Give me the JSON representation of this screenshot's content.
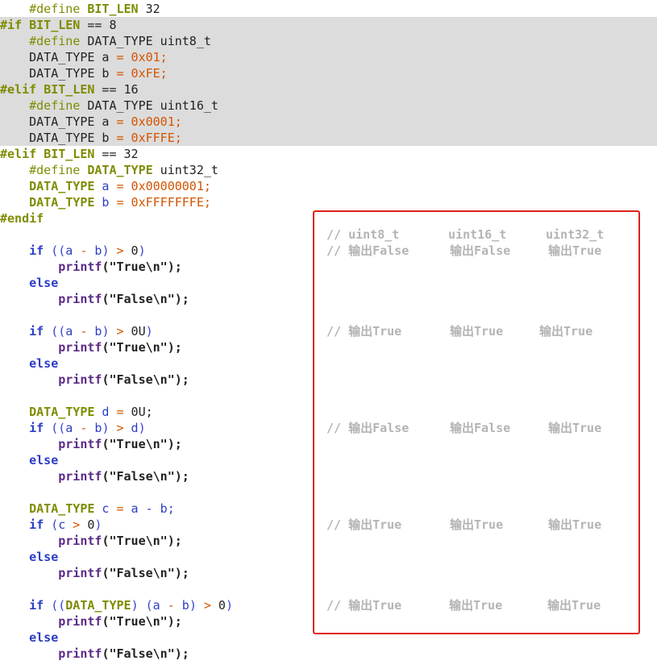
{
  "code": {
    "l1": {
      "a": "#define ",
      "b": "BIT_LEN",
      "c": " 32"
    },
    "l2": {
      "a": "#if ",
      "b": "BIT_LEN",
      "c": " == ",
      "d": "8"
    },
    "l3": {
      "a": "#define ",
      "b": "DATA_TYPE uint8_t"
    },
    "l4": {
      "a": "DATA_TYPE a ",
      "b": "=",
      "c": " 0x01;"
    },
    "l5": {
      "a": "DATA_TYPE b ",
      "b": "=",
      "c": " 0xFE;"
    },
    "l6": {
      "a": "#elif ",
      "b": "BIT_LEN",
      "c": " == ",
      "d": "16"
    },
    "l7": {
      "a": "#define ",
      "b": "DATA_TYPE uint16_t"
    },
    "l8": {
      "a": "DATA_TYPE a ",
      "b": "=",
      "c": " 0x0001;"
    },
    "l9": {
      "a": "DATA_TYPE b ",
      "b": "=",
      "c": " 0xFFFE;"
    },
    "l10": {
      "a": "#elif ",
      "b": "BIT_LEN",
      "c": " == ",
      "d": "32"
    },
    "l11": {
      "a": "#define ",
      "b": "DATA_TYPE",
      "c": " uint32_t"
    },
    "l12": {
      "a": "DATA_TYPE",
      "b": " a ",
      "c": "=",
      "d": " 0x00000001;"
    },
    "l13": {
      "a": "DATA_TYPE",
      "b": " b ",
      "c": "=",
      "d": " 0xFFFFFFFE;"
    },
    "l14": {
      "a": "#endif"
    },
    "if1": {
      "kw": "if ",
      "p1": "((",
      "a": "a",
      "m": " - ",
      "b": "b",
      "p2": ") ",
      "gt": ">",
      "z": " 0",
      "p3": ")"
    },
    "printf": "printf",
    "true_str": "(\"True\\n\");",
    "false_str": "(\"False\\n\");",
    "else": "else",
    "if2": {
      "kw": "if ",
      "p1": "((",
      "a": "a",
      "m": " - ",
      "b": "b",
      "p2": ") ",
      "gt": ">",
      "z": " 0U",
      "p3": ")"
    },
    "decl_d": {
      "t": "DATA_TYPE",
      "v": " d ",
      "eq": "=",
      "val": " 0U;"
    },
    "if3": {
      "kw": "if ",
      "p1": "((",
      "a": "a",
      "m": " - ",
      "b": "b",
      "p2": ") ",
      "gt": ">",
      "z": " d",
      "p3": ")"
    },
    "decl_c": {
      "t": "DATA_TYPE",
      "v": " c ",
      "eq": "=",
      "val": " a - b;"
    },
    "if4": {
      "kw": "if ",
      "p1": "(",
      "a": "c",
      "gt": " > ",
      "z": "0",
      "p3": ")"
    },
    "if5": {
      "kw": "if ",
      "p1": "((",
      "t": "DATA_TYPE",
      "p2": ") ",
      "p4": "(",
      "a": "a",
      "m": " - ",
      "b": "b",
      "p5": ") ",
      "gt": ">",
      "z": " 0",
      "p3": ")"
    }
  },
  "annotations": {
    "header": [
      "// uint8_t",
      "uint16_t",
      "uint32_t"
    ],
    "rows": [
      [
        "// 输出False",
        "输出False",
        "输出True"
      ],
      [
        "// 输出True",
        "输出True",
        "输出True"
      ],
      [
        "// 输出False",
        "输出False",
        "输出True"
      ],
      [
        "// 输出True",
        "输出True",
        "输出True"
      ],
      [
        "// 输出True",
        "输出True",
        "输出True"
      ]
    ]
  },
  "colors": {
    "highlight_bg": "#dcdcdc",
    "box_border": "#e0201a",
    "comment": "#b4b4b4",
    "keyword": "#7f8c00",
    "number": "#d35400",
    "variable": "#2c3ec4",
    "function": "#5b2a86"
  }
}
